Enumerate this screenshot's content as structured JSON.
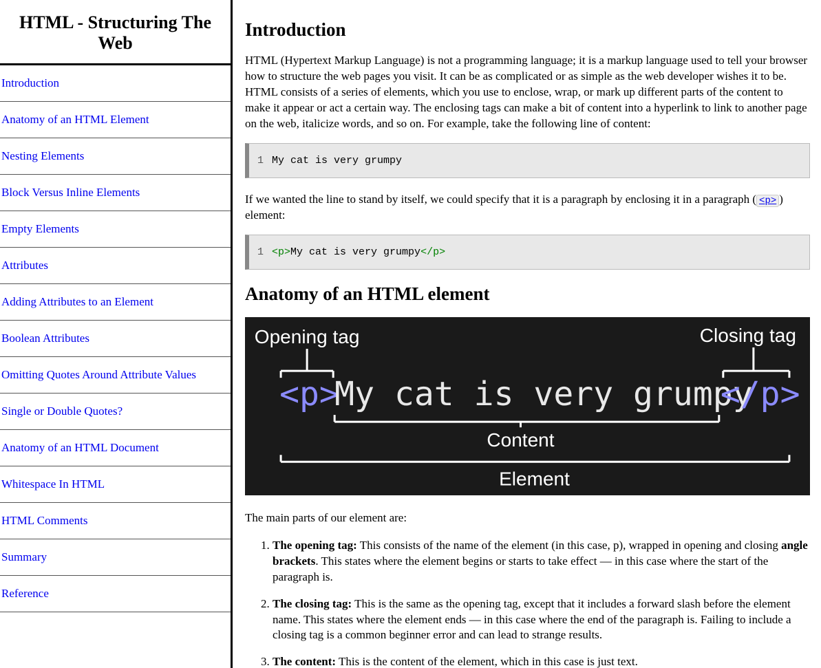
{
  "sidebar": {
    "title": "HTML - Structuring The Web",
    "items": [
      "Introduction",
      "Anatomy of an HTML Element",
      "Nesting Elements",
      "Block Versus Inline Elements",
      "Empty Elements",
      "Attributes",
      "Adding Attributes to an Element",
      "Boolean Attributes",
      "Omitting Quotes Around Attribute Values",
      "Single or Double Quotes?",
      "Anatomy of an HTML Document",
      "Whitespace In HTML",
      "HTML Comments",
      "Summary",
      "Reference"
    ]
  },
  "main": {
    "intro": {
      "heading": "Introduction",
      "p1": "HTML (Hypertext Markup Language) is not a programming language; it is a markup language used to tell your browser how to structure the web pages you visit. It can be as complicated or as simple as the web developer wishes it to be. HTML consists of a series of elements, which you use to enclose, wrap, or mark up different parts of the content to make it appear or act a certain way. The enclosing tags can make a bit of content into a hyperlink to link to another page on the web, italicize words, and so on. For example, take the following line of content:",
      "code1_ln": "1",
      "code1_text": "My cat is very grumpy",
      "p2_a": "If we wanted the line to stand by itself, we could specify that it is a paragraph by enclosing it in a paragraph (",
      "p2_code": "<p>",
      "p2_b": ") element:",
      "code2_ln": "1",
      "code2_open": "<p>",
      "code2_content": "My cat is very grumpy",
      "code2_close": "</p>"
    },
    "anatomy": {
      "heading": "Anatomy of an HTML element",
      "diagram": {
        "opening_label": "Opening tag",
        "closing_label": "Closing tag",
        "open_tag": "<p>",
        "content": "My cat is very grumpy",
        "close_tag": "</p>",
        "content_label": "Content",
        "element_label": "Element"
      },
      "parts_intro": "The main parts of our element are:",
      "parts": [
        {
          "bold": "The opening tag:",
          "text_a": " This consists of the name of the element (in this case, p), wrapped in opening and closing ",
          "bold2": "angle brackets",
          "text_b": ". This states where the element begins or starts to take effect — in this case where the start of the paragraph is."
        },
        {
          "bold": "The closing tag:",
          "text_a": " This is the same as the opening tag, except that it includes a forward slash before the element name. This states where the element ends — in this case where the end of the paragraph is. Failing to include a closing tag is a common beginner error and can lead to strange results.",
          "bold2": "",
          "text_b": ""
        },
        {
          "bold": "The content:",
          "text_a": " This is the content of the element, which in this case is just text.",
          "bold2": "",
          "text_b": ""
        }
      ]
    }
  }
}
